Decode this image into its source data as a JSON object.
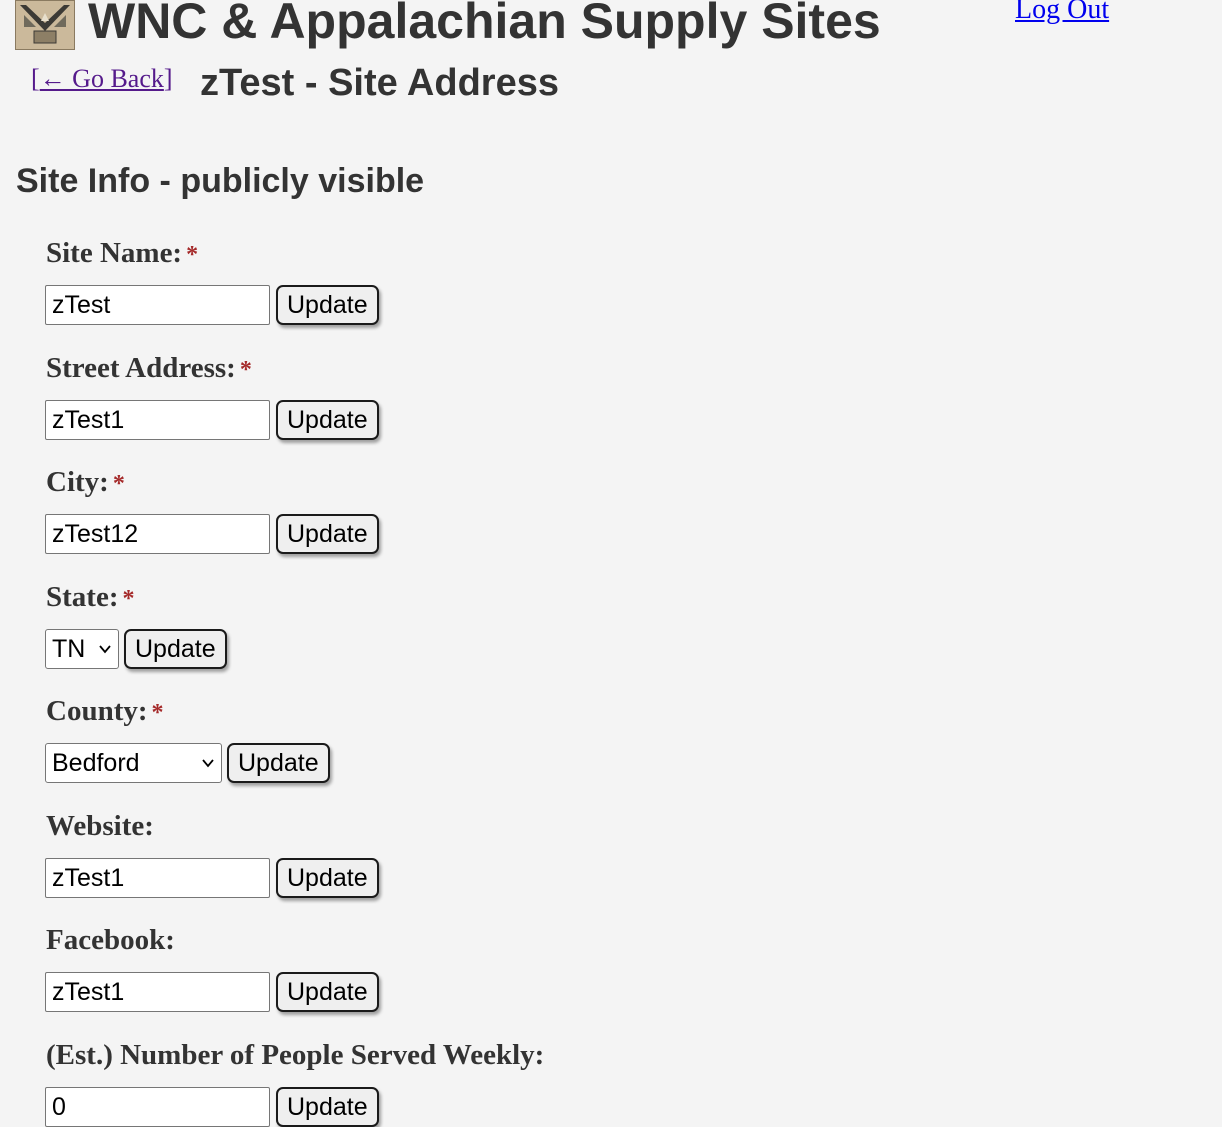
{
  "header": {
    "site_title": "WNC & Appalachian Supply Sites",
    "logout_label": "Log Out",
    "go_back_label": "← Go Back",
    "page_title": "zTest - Site Address"
  },
  "section": {
    "heading": "Site Info - publicly visible",
    "required_marker": "*",
    "update_label": "Update",
    "fields": {
      "site_name": {
        "label": "Site Name:",
        "value": "zTest"
      },
      "street_address": {
        "label": "Street Address:",
        "value": "zTest1"
      },
      "city": {
        "label": "City:",
        "value": "zTest12"
      },
      "state": {
        "label": "State:",
        "selected": "TN"
      },
      "county": {
        "label": "County:",
        "selected": "Bedford"
      },
      "website": {
        "label": "Website:",
        "value": "zTest1"
      },
      "facebook": {
        "label": "Facebook:",
        "value": "zTest1"
      },
      "people_served": {
        "label": "(Est.) Number of People Served Weekly:",
        "value": "0"
      }
    }
  },
  "icons": {
    "logo": "supply-sites-logo-icon",
    "dropdown": "chevron-down-icon"
  }
}
